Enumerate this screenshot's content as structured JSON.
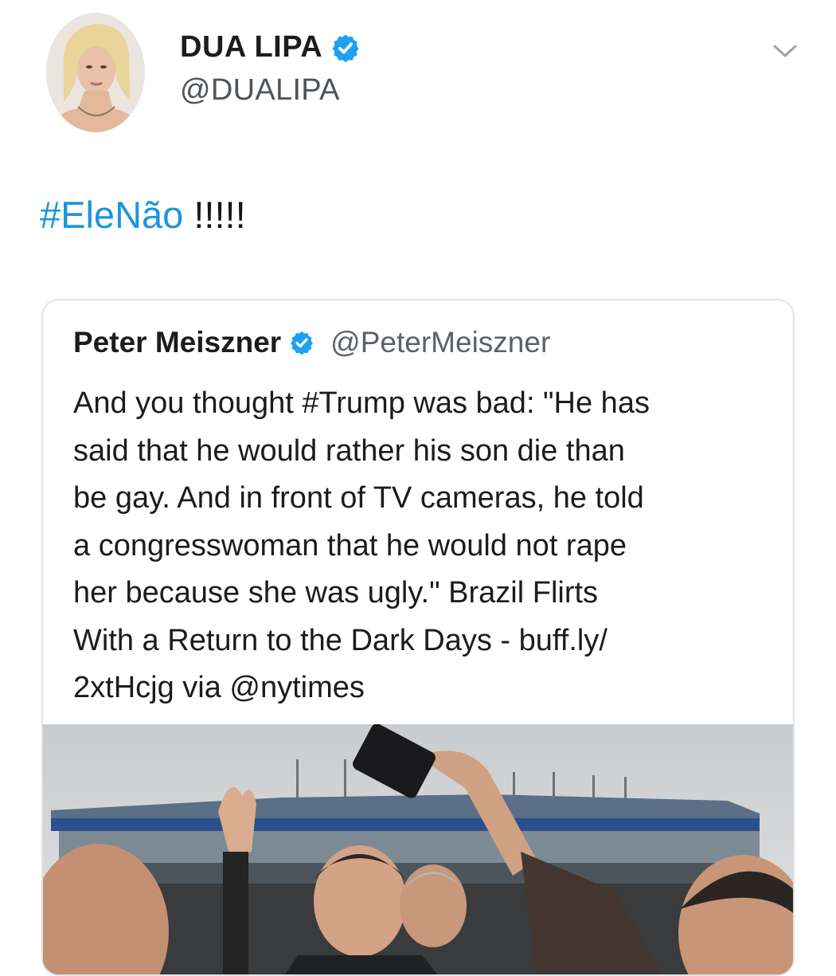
{
  "author": {
    "display_name": "DUA LIPA",
    "handle": "@DUALIPA"
  },
  "tweet": {
    "hashtag": "#EleNão",
    "suffix": " !!!!!"
  },
  "quoted_tweet": {
    "display_name": "Peter Meiszner",
    "handle": "@PeterMeiszner",
    "text_lines": [
      "And you thought #Trump was bad: \"He has",
      "said that he would rather his son die than",
      "be gay. And in front of TV cameras, he told",
      "a congresswoman that he would not rape",
      "her because she was ugly.\" Brazil Flirts",
      "With a Return to the Dark Days - buff.ly/",
      "2xtHcjg via @nytimes"
    ]
  },
  "icons": {
    "verified": "verified-badge-icon",
    "menu": "chevron-down-icon"
  },
  "colors": {
    "hashtag": "#1b95e0",
    "verified": "#1da1f2",
    "card_border": "#dfe3e7"
  }
}
